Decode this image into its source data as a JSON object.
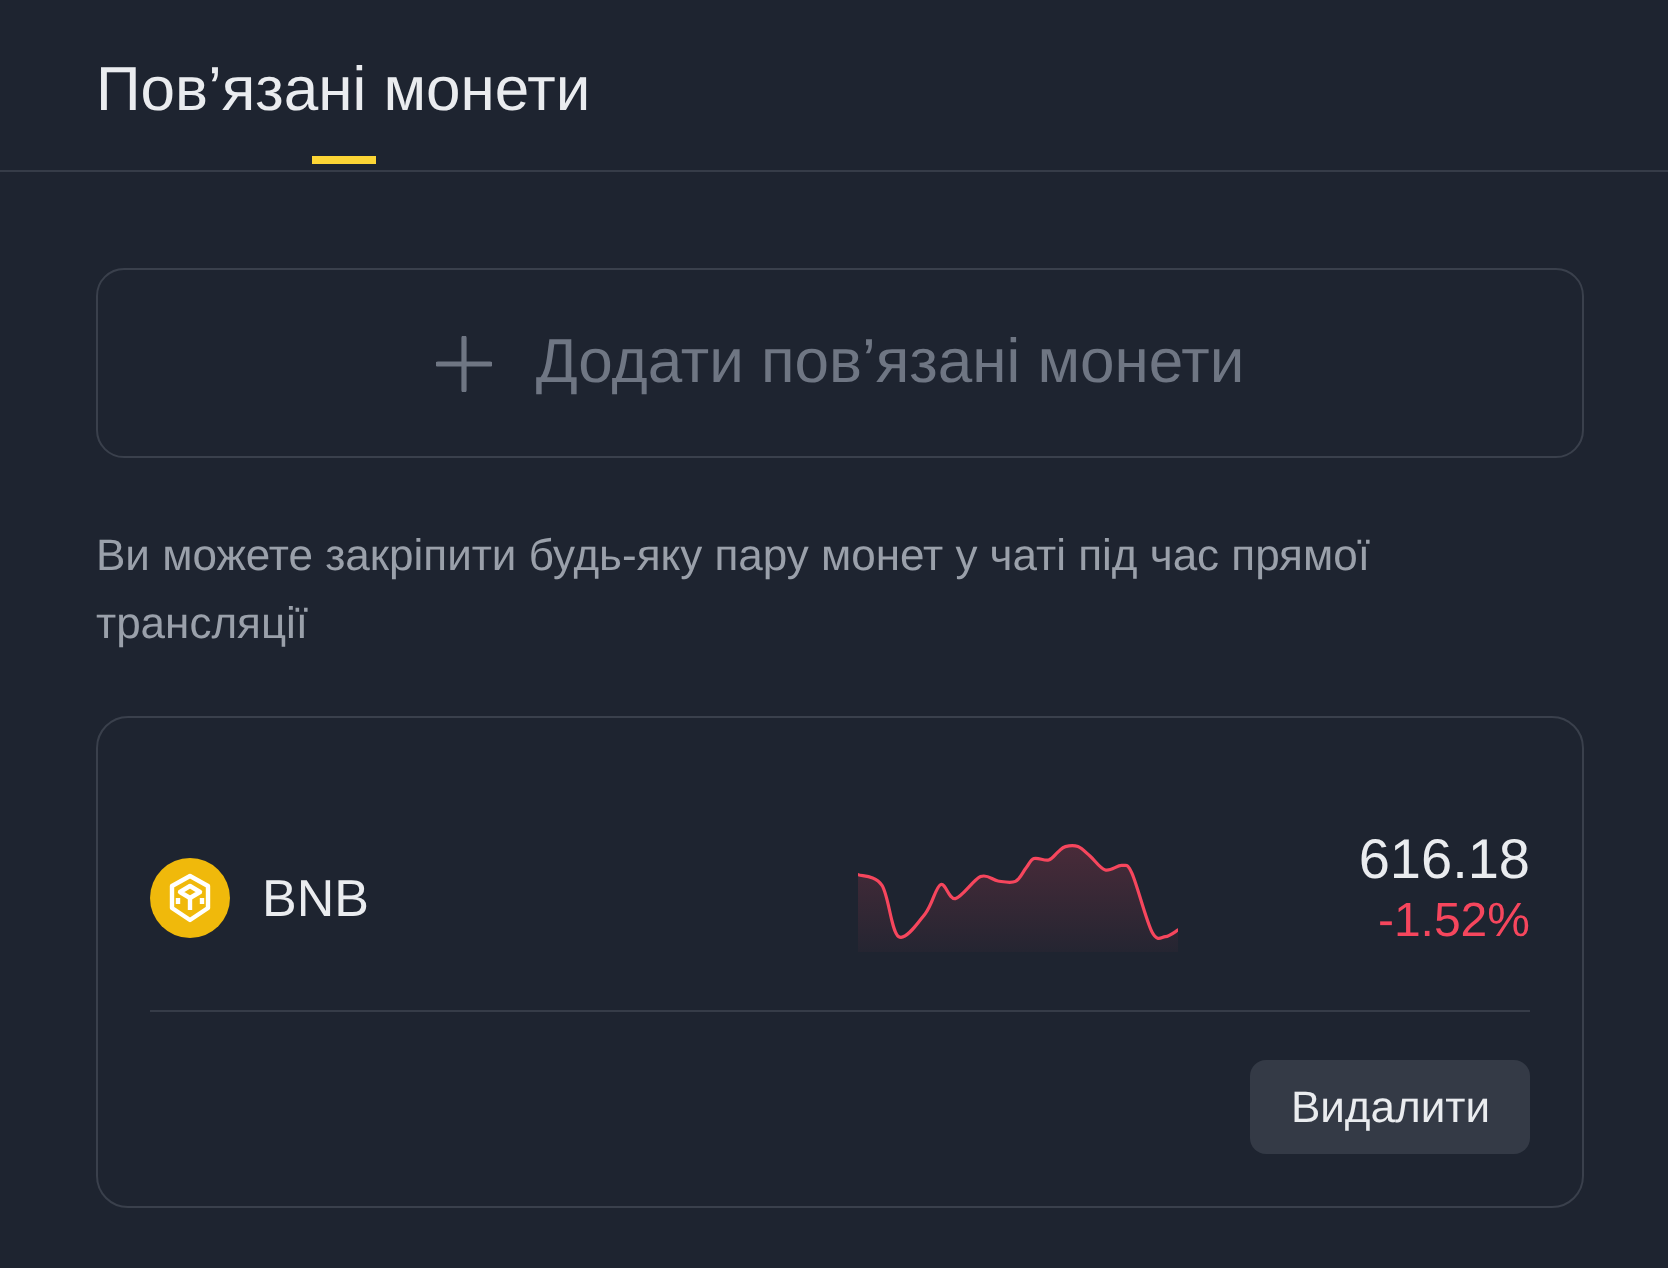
{
  "tabs": [
    {
      "label": "Пов’язані монети",
      "selected": true
    }
  ],
  "add_button": {
    "label": "Додати пов’язані монети"
  },
  "hint": "Ви можете закріпити будь-яку пару монет у чаті під час прямої трансляції",
  "coins": [
    {
      "symbol": "BNB",
      "price": "616.18",
      "change": "-1.52%",
      "falling": true,
      "remove_button": "Видалити"
    }
  ]
}
